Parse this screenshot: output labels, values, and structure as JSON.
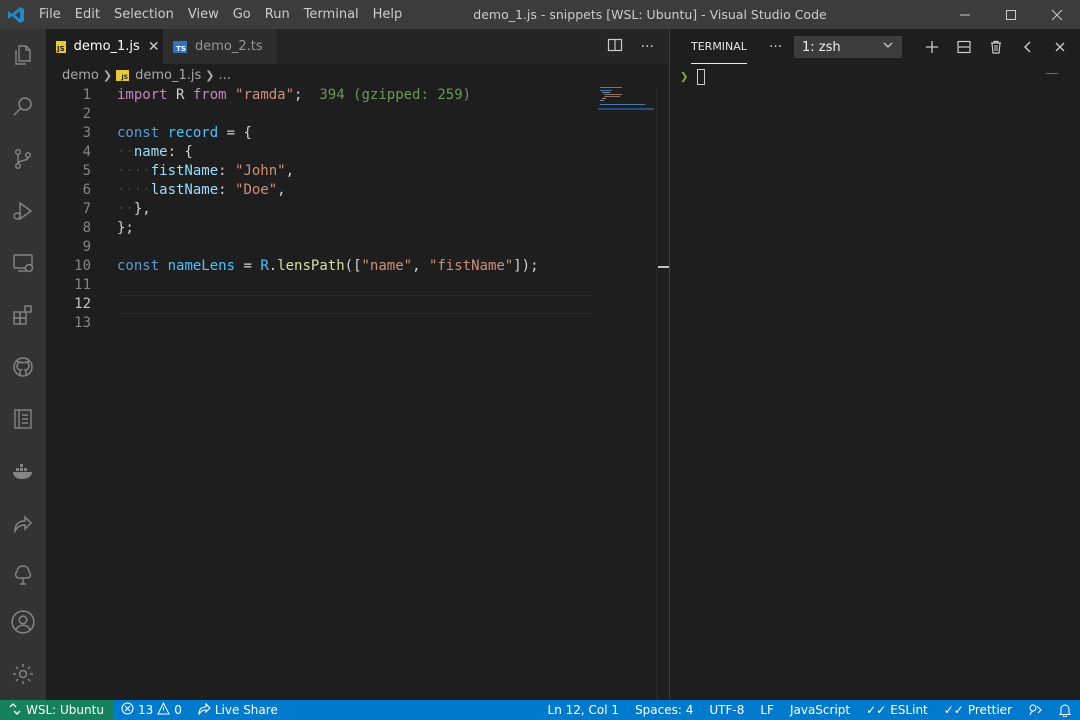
{
  "titlebar": {
    "menu": [
      "File",
      "Edit",
      "Selection",
      "View",
      "Go",
      "Run",
      "Terminal",
      "Help"
    ],
    "title": "demo_1.js - snippets [WSL: Ubuntu] - Visual Studio Code"
  },
  "activity_bar": {
    "items": [
      "explorer-icon",
      "search-icon",
      "source-control-icon",
      "run-debug-icon",
      "remote-explorer-icon",
      "extensions-icon",
      "github-icon",
      "notebook-icon",
      "docker-icon",
      "live-share-icon",
      "test-tree-icon"
    ],
    "bottom": [
      "account-icon",
      "settings-gear-icon"
    ]
  },
  "editor": {
    "tabs": [
      {
        "label": "demo_1.js",
        "badge": "JS",
        "active": true
      },
      {
        "label": "demo_2.ts",
        "badge": "TS",
        "active": false
      }
    ],
    "breadcrumb": {
      "folder": "demo",
      "file": "demo_1.js",
      "more": "..."
    },
    "current_line": 12,
    "lines": [
      {
        "n": "1",
        "segments": [
          [
            "kw2",
            "import"
          ],
          [
            "pl",
            " R "
          ],
          [
            "kw2",
            "from"
          ],
          [
            "pl",
            " "
          ],
          [
            "str",
            "\"ramda\""
          ],
          [
            "pl",
            ";  "
          ],
          [
            "hint",
            "394 (gzipped: 259)"
          ]
        ]
      },
      {
        "n": "2",
        "segments": []
      },
      {
        "n": "3",
        "segments": [
          [
            "kw",
            "const"
          ],
          [
            "pl",
            " "
          ],
          [
            "var",
            "record"
          ],
          [
            "pl",
            " = {"
          ]
        ]
      },
      {
        "n": "4",
        "segments": [
          [
            "ws",
            "··"
          ],
          [
            "id",
            "name"
          ],
          [
            "pl",
            ": {"
          ]
        ]
      },
      {
        "n": "5",
        "segments": [
          [
            "ws",
            "····"
          ],
          [
            "id",
            "fistName"
          ],
          [
            "pl",
            ": "
          ],
          [
            "str",
            "\"John\""
          ],
          [
            "pl",
            ","
          ]
        ]
      },
      {
        "n": "6",
        "segments": [
          [
            "ws",
            "····"
          ],
          [
            "id",
            "lastName"
          ],
          [
            "pl",
            ": "
          ],
          [
            "str",
            "\"Doe\""
          ],
          [
            "pl",
            ","
          ]
        ]
      },
      {
        "n": "7",
        "segments": [
          [
            "ws",
            "··"
          ],
          [
            "pl",
            "},"
          ]
        ]
      },
      {
        "n": "8",
        "segments": [
          [
            "pl",
            "};"
          ]
        ]
      },
      {
        "n": "9",
        "segments": []
      },
      {
        "n": "10",
        "segments": [
          [
            "kw",
            "const"
          ],
          [
            "pl",
            " "
          ],
          [
            "var",
            "nameLens"
          ],
          [
            "pl",
            " = "
          ],
          [
            "var",
            "R"
          ],
          [
            "pl",
            "."
          ],
          [
            "fn",
            "lensPath"
          ],
          [
            "pl",
            "(["
          ],
          [
            "str",
            "\"name\""
          ],
          [
            "pl",
            ", "
          ],
          [
            "str",
            "\"fistName\""
          ],
          [
            "pl",
            "]);"
          ]
        ]
      },
      {
        "n": "11",
        "segments": []
      },
      {
        "n": "12",
        "segments": []
      },
      {
        "n": "13",
        "segments": []
      }
    ]
  },
  "panel": {
    "title": "TERMINAL",
    "more": "···",
    "terminal_select": "1: zsh",
    "prompt": "❯"
  },
  "statusbar": {
    "remote": "WSL: Ubuntu",
    "errors": "13",
    "warnings": "0",
    "live_share": "Live Share",
    "position": "Ln 12, Col 1",
    "spaces": "Spaces: 4",
    "encoding": "UTF-8",
    "eol": "LF",
    "language": "JavaScript",
    "eslint": "ESLint",
    "prettier": "Prettier"
  },
  "colors": {
    "statusbar": "#007acc",
    "remote": "#16825d",
    "titlebar": "#3c3c3c",
    "activity": "#333333",
    "editor": "#1e1e1e"
  }
}
